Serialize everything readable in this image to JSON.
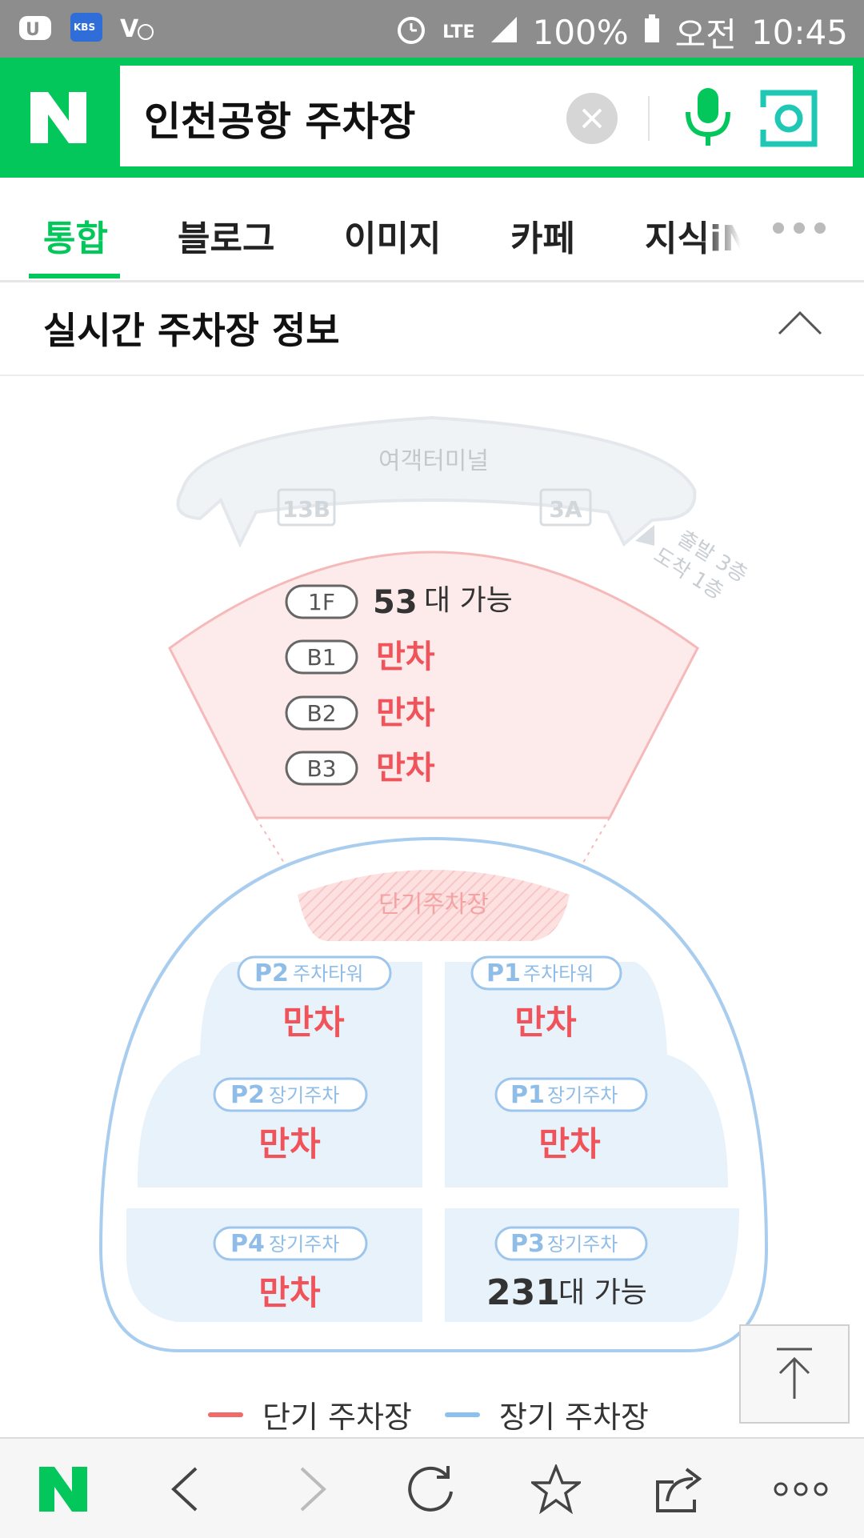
{
  "status_bar": {
    "battery": "100%",
    "ampm": "오전",
    "time": "10:45",
    "network": "LTE",
    "kbs_text": "KBS"
  },
  "search": {
    "query": "인천공항 주차장"
  },
  "tabs": [
    {
      "label": "통합",
      "active": true
    },
    {
      "label": "블로그"
    },
    {
      "label": "이미지"
    },
    {
      "label": "카페"
    },
    {
      "label": "지식iN"
    }
  ],
  "section": {
    "title": "실시간 주차장 정보"
  },
  "map": {
    "terminal_label": "여객터미널",
    "gate_left": "13B",
    "gate_right": "3A",
    "direction_line1": "출발 3층",
    "direction_line2": "도착 1층",
    "short_term_label": "단기주차장",
    "short_term_floors": [
      {
        "floor": "1F",
        "count": "53",
        "unit": "대 가능",
        "full": false
      },
      {
        "floor": "B1",
        "status": "만차",
        "full": true
      },
      {
        "floor": "B2",
        "status": "만차",
        "full": true
      },
      {
        "floor": "B3",
        "status": "만차",
        "full": true
      }
    ],
    "long_term_lots": [
      {
        "code": "P2",
        "name": "주차타워",
        "status": "만차"
      },
      {
        "code": "P1",
        "name": "주차타워",
        "status": "만차"
      },
      {
        "code": "P2",
        "name": "장기주차",
        "status": "만차"
      },
      {
        "code": "P1",
        "name": "장기주차",
        "status": "만차"
      },
      {
        "code": "P4",
        "name": "장기주차",
        "status": "만차"
      },
      {
        "code": "P3",
        "name": "장기주차",
        "count": "231",
        "unit": "대 가능"
      }
    ]
  },
  "legend": {
    "short_term": "단기 주차장",
    "long_term": "장기 주차장"
  },
  "colors": {
    "naver_green": "#03c75a",
    "full_red": "#f0545a",
    "short_pink": "#fbe3e3",
    "long_blue": "#e8f2fb",
    "long_stroke": "#a9cdee"
  }
}
